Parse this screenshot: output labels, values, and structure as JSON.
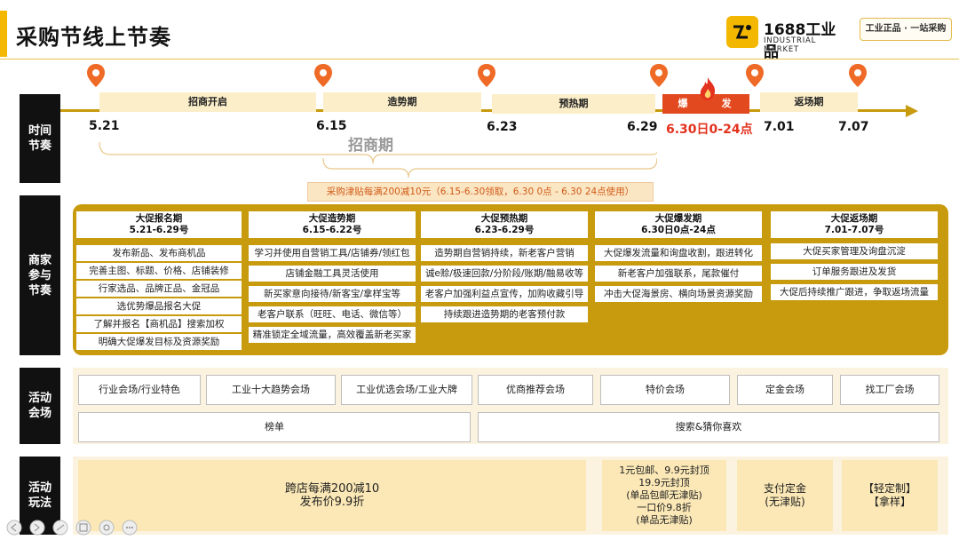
{
  "header": {
    "title": "采购节线上节奏",
    "logo_main": "1688工业品",
    "logo_sub": "INDUSTRIAL MARKET",
    "slogan": "工业正品 · 一站采购"
  },
  "sections": {
    "timeline": "时间\n节奏",
    "merchant": "商家\n参与\n节奏",
    "venue": "活动\n会场",
    "play": "活动\n玩法"
  },
  "timeline": {
    "phases": [
      "招商开启",
      "造势期",
      "预热期",
      "爆",
      "发",
      "返场期"
    ],
    "dates": [
      "5.21",
      "6.15",
      "6.23",
      "6.29",
      "6.30日0-24点",
      "7.01",
      "7.07"
    ],
    "recruit_label": "招商期",
    "subsidy": "采购津贴每满200减10元（6.15-6.30领取，6.30  0点 - 6.30  24点使用）"
  },
  "merchant_columns": [
    {
      "title": "大促报名期",
      "dates": "5.21-6.29号",
      "items": [
        "发布新品、发布商机品",
        "完善主图、标题、价格、店铺装修",
        "行家选品、品牌正品、金冠品",
        "选优势爆品报名大促",
        "了解并报名【商机品】搜索加权",
        "明确大促爆发目标及资源奖励"
      ]
    },
    {
      "title": "大促造势期",
      "dates": "6.15-6.22号",
      "items": [
        "学习并使用自营销工具/店铺券/领红包",
        "店铺金融工具灵活使用",
        "新买家意向接待/新客宝/拿样宝等",
        "老客户联系（旺旺、电话、微信等）",
        "精准锁定全域流量，高效覆盖新老买家"
      ]
    },
    {
      "title": "大促预热期",
      "dates": "6.23-6.29号",
      "items": [
        "造势期自营销持续，新老客户营销",
        "诚e赊/极速回款/分阶段/账期/融易收等",
        "老客户加强利益点宣传，加购收藏引导",
        "持续跟进造势期的老客预付款"
      ]
    },
    {
      "title": "大促爆发期",
      "dates": "6.30日0点-24点",
      "items": [
        "大促爆发流量和询盘收割，跟进转化",
        "新老客户加强联系，尾款催付",
        "冲击大促海景房、横向场景资源奖励"
      ]
    },
    {
      "title": "大促返场期",
      "dates": "7.01-7.07号",
      "items": [
        "大促买家管理及询盘沉淀",
        "订单服务跟进及发货",
        "大促后持续推广跟进，争取返场流量"
      ]
    }
  ],
  "venues": {
    "row1": [
      "行业会场/行业特色",
      "工业十大趋势会场",
      "工业优选会场/工业大牌",
      "优商推荐会场",
      "特价会场",
      "定金会场",
      "找工厂会场"
    ],
    "row2": [
      "榜单",
      "搜索&猜你喜欢"
    ]
  },
  "plays": [
    "跨店每满200减10\n发布价9.9折",
    "1元包邮、9.9元封顶\n19.9元封顶\n(单品包邮无津贴)\n一口价9.8折\n(单品无津贴)",
    "支付定金\n(无津贴)",
    "【轻定制】\n【拿样】"
  ],
  "colors": {
    "accent": "#f5b800",
    "gold": "#c89a0d",
    "red": "#e3491e"
  }
}
